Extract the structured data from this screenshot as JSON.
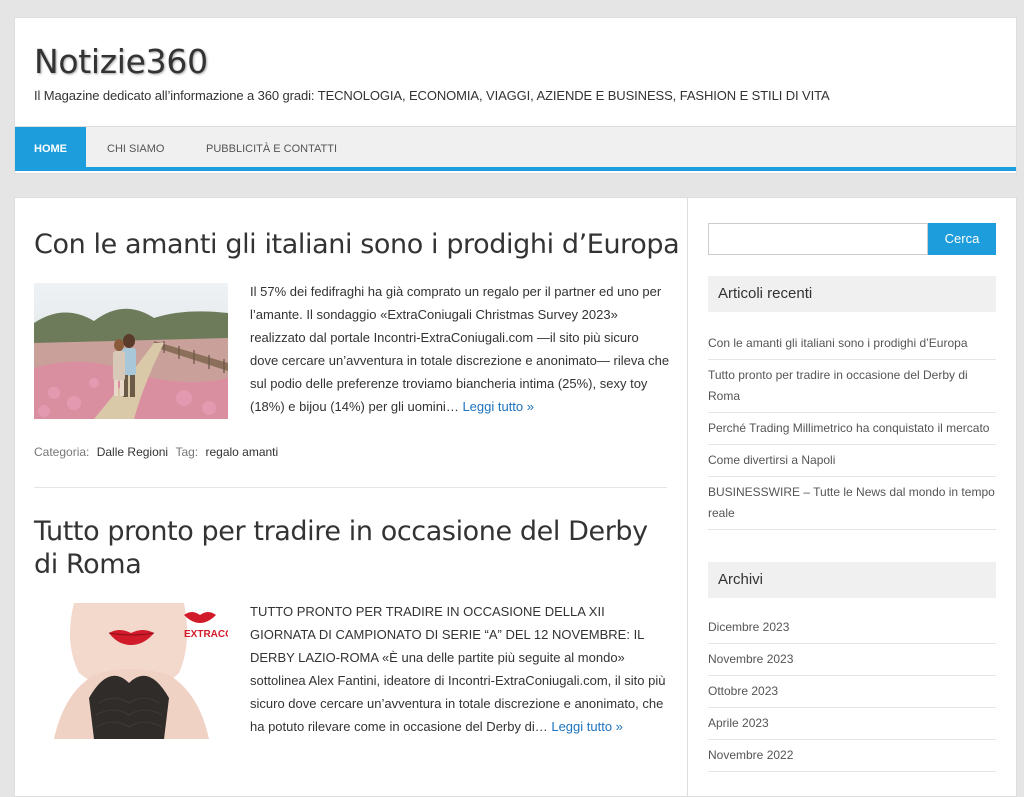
{
  "header": {
    "title": "Notizie360",
    "description": "Il Magazine dedicato all’informazione a 360 gradi: TECNOLOGIA, ECONOMIA, VIAGGI, AZIENDE E BUSINESS, FASHION E STILI DI VITA"
  },
  "nav": {
    "items": [
      "HOME",
      "CHI SIAMO",
      "PUBBLICITÀ E CONTATTI"
    ]
  },
  "posts": [
    {
      "title": "Con le amanti gli italiani sono i prodighi d’Europa",
      "excerpt": "Il 57% dei fedifraghi ha già comprato un regalo per il partner ed uno per l’amante. Il sondaggio «ExtraConiugali Christmas Survey 2023» realizzato dal portale Incontri-ExtraConiugali.com —il sito più sicuro dove cercare un’avventura in totale discrezione e anonimato— rileva che sul podio delle preferenze troviamo biancheria intima (25%), sexy toy (18%) e bijou (14%) per gli uomini…",
      "more": "Leggi tutto »",
      "category_label": "Categoria:",
      "category": "Dalle Regioni",
      "tag_label": "Tag:",
      "tag": "regalo amanti"
    },
    {
      "title": "Tutto pronto per tradire in occasione del Derby di Roma",
      "excerpt": "TUTTO PRONTO PER TRADIRE IN OCCASIONE DELLA XII GIORNATA DI CAMPIONATO DI SERIE “A” DEL 12 NOVEMBRE: IL DERBY LAZIO-ROMA «È una delle partite più seguite al mondo» sottolinea Alex Fantini, ideatore di Incontri-ExtraConiugali.com, il sito più sicuro dove cercare un’avventura in totale discrezione e anonimato, che ha potuto rilevare come in occasione del Derby di…",
      "more": "Leggi tutto »",
      "thumb_text": "EXTRACO"
    }
  ],
  "sidebar": {
    "search_button": "Cerca",
    "recent_title": "Articoli recenti",
    "recent": [
      "Con le amanti gli italiani sono i prodighi d’Europa",
      "Tutto pronto per tradire in occasione del Derby di Roma",
      "Perché Trading Millimetrico ha conquistato il mercato",
      "Come divertirsi a Napoli",
      "BUSINESSWIRE – Tutte le News dal mondo in tempo reale"
    ],
    "archive_title": "Archivi",
    "archives": [
      "Dicembre 2023",
      "Novembre 2023",
      "Ottobre 2023",
      "Aprile 2023",
      "Novembre 2022"
    ]
  },
  "colors": {
    "accent": "#1e9ddc",
    "link": "#1e73be"
  }
}
